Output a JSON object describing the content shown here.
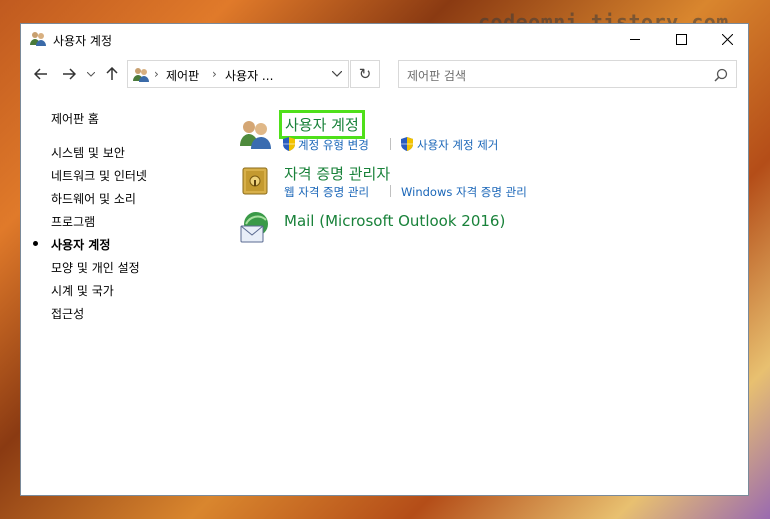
{
  "watermark": "codeomni.tistory.com",
  "window": {
    "title": "사용자 계정",
    "controls": {
      "minimize": "minimize-icon",
      "maximize": "maximize-icon",
      "close": "close-icon"
    }
  },
  "nav": {
    "back_icon": "back-arrow-icon",
    "forward_icon": "forward-arrow-icon",
    "recent_icon": "chevron-down-icon",
    "up_icon": "up-arrow-icon",
    "breadcrumb": [
      "제어판",
      "사용자 ..."
    ],
    "refresh_icon": "refresh-icon",
    "search_placeholder": "제어판 검색"
  },
  "sidebar": {
    "home": "제어판 홈",
    "items": [
      {
        "label": "시스템 및 보안",
        "active": false
      },
      {
        "label": "네트워크 및 인터넷",
        "active": false
      },
      {
        "label": "하드웨어 및 소리",
        "active": false
      },
      {
        "label": "프로그램",
        "active": false
      },
      {
        "label": "사용자 계정",
        "active": true
      },
      {
        "label": "모양 및 개인 설정",
        "active": false
      },
      {
        "label": "시계 및 국가",
        "active": false
      },
      {
        "label": "접근성",
        "active": false
      }
    ]
  },
  "categories": [
    {
      "title": "사용자 계정",
      "icon": "user-accounts-icon",
      "highlighted": true,
      "links": [
        {
          "label": "계정 유형 변경",
          "shield": true
        },
        {
          "label": "사용자 계정 제거",
          "shield": true
        }
      ]
    },
    {
      "title": "자격 증명 관리자",
      "icon": "credential-manager-icon",
      "highlighted": false,
      "links": [
        {
          "label": "웹 자격 증명 관리",
          "shield": false
        },
        {
          "label": "Windows 자격 증명 관리",
          "shield": false
        }
      ]
    },
    {
      "title": "Mail (Microsoft Outlook 2016)",
      "icon": "mail-icon",
      "highlighted": false,
      "links": []
    }
  ],
  "colors": {
    "category_title": "#19823a",
    "link": "#1a66b8",
    "highlight_box": "#4fe01a"
  }
}
